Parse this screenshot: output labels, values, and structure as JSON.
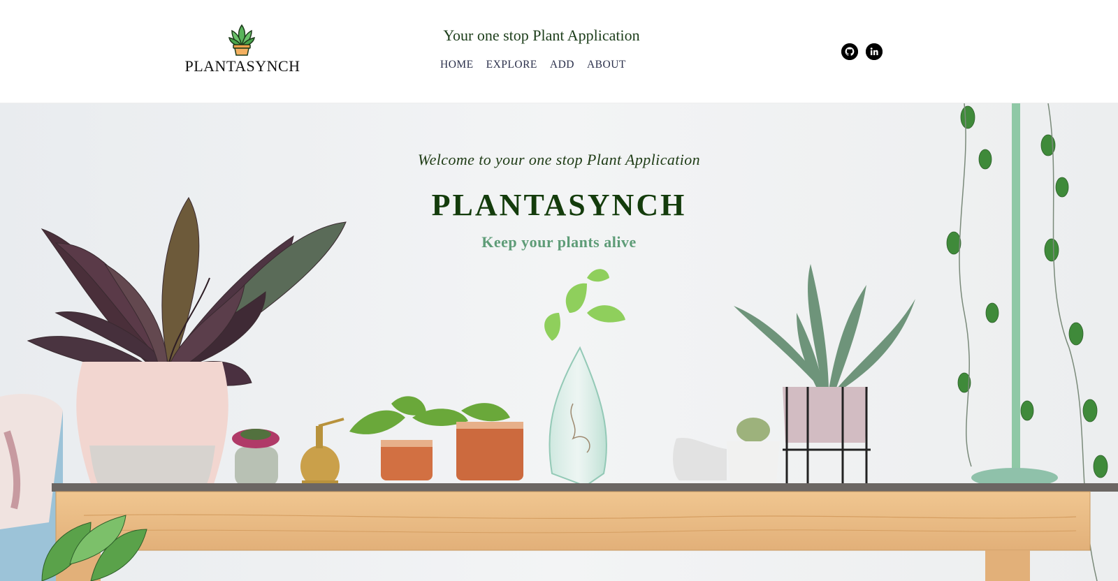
{
  "header": {
    "brand": "PLANTASYNCH",
    "tagline": "Your one stop Plant Application",
    "nav": [
      {
        "label": "HOME"
      },
      {
        "label": "EXPLORE"
      },
      {
        "label": "ADD"
      },
      {
        "label": "ABOUT"
      }
    ],
    "social": [
      {
        "icon": "github-icon"
      },
      {
        "icon": "linkedin-icon"
      }
    ]
  },
  "hero": {
    "welcome": "Welcome to your one stop Plant Application",
    "title": "PLANTASYNCH",
    "subtitle": "Keep your plants alive"
  },
  "colors": {
    "title_green": "#143c0c",
    "subtitle_green": "#5e9c77",
    "nav_text": "#2a2f4a",
    "wall": "#eef0f2",
    "table_wood": "#e9bd85"
  }
}
